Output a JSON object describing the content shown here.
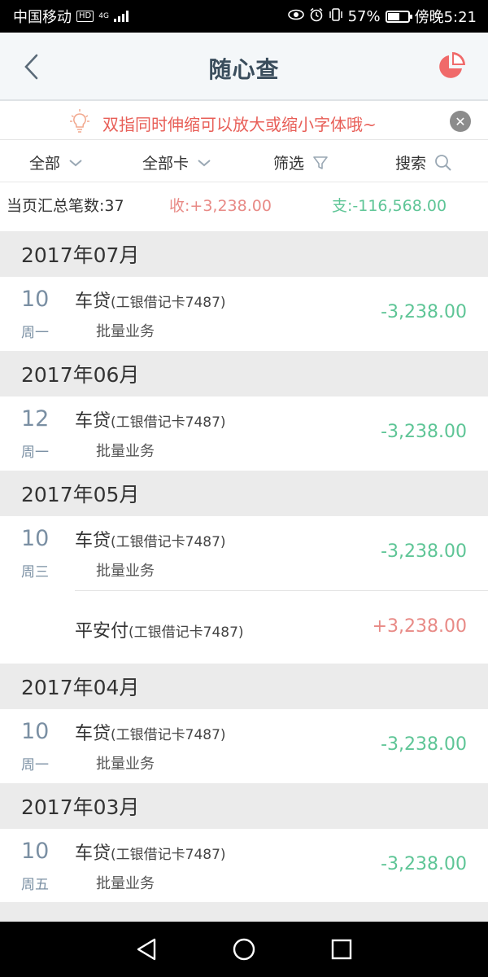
{
  "status_bar": {
    "carrier": "中国移动",
    "hd": "HD",
    "network": "4G",
    "battery_percent": "57%",
    "battery_level": 0.57,
    "time": "傍晚5:21"
  },
  "header": {
    "title": "随心查",
    "back_icon": "chevron-left-icon",
    "chart_icon": "pie-chart-icon",
    "accent_color": "#f06a6a"
  },
  "tip": {
    "text": "双指同时伸缩可以放大或缩小字体哦~",
    "icon": "lightbulb-icon",
    "close_icon": "close-icon"
  },
  "filters": {
    "all_label": "全部",
    "all_cards_label": "全部卡",
    "filter_label": "筛选",
    "search_label": "搜索"
  },
  "summary": {
    "count_label": "当页汇总笔数:37",
    "income_label": "收:+3,238.00",
    "expense_label": "支:-116,568.00"
  },
  "colors": {
    "expense": "#5ec596",
    "income": "#e88a86",
    "date": "#7a8fa3"
  },
  "months": [
    {
      "label": "2017年07月",
      "transactions": [
        {
          "day": "10",
          "weekday": "周一",
          "title": "车贷",
          "card": "(工银借记卡7487)",
          "desc": "批量业务",
          "amount": "-3,238.00"
        }
      ]
    },
    {
      "label": "2017年06月",
      "transactions": [
        {
          "day": "12",
          "weekday": "周一",
          "title": "车贷",
          "card": "(工银借记卡7487)",
          "desc": "批量业务",
          "amount": "-3,238.00"
        }
      ]
    },
    {
      "label": "2017年05月",
      "transactions": [
        {
          "day": "10",
          "weekday": "周三",
          "title": "车贷",
          "card": "(工银借记卡7487)",
          "desc": "批量业务",
          "amount": "-3,238.00"
        }
      ],
      "sub_transaction": {
        "title": "平安付",
        "card": "(工银借记卡7487)",
        "amount": "+3,238.00"
      }
    },
    {
      "label": "2017年04月",
      "transactions": [
        {
          "day": "10",
          "weekday": "周一",
          "title": "车贷",
          "card": "(工银借记卡7487)",
          "desc": "批量业务",
          "amount": "-3,238.00"
        }
      ]
    },
    {
      "label": "2017年03月",
      "transactions": [
        {
          "day": "10",
          "weekday": "周五",
          "title": "车贷",
          "card": "(工银借记卡7487)",
          "desc": "批量业务",
          "amount": "-3,238.00"
        }
      ]
    }
  ],
  "nav": {
    "back_icon": "nav-back-icon",
    "home_icon": "nav-home-icon",
    "recents_icon": "nav-recents-icon"
  }
}
